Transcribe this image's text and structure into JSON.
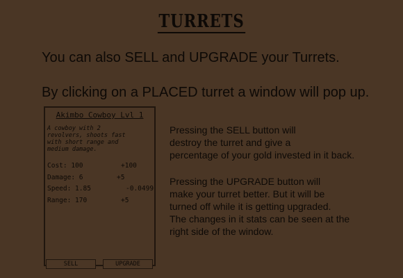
{
  "header": {
    "title": "TURRETS"
  },
  "intro": {
    "line1": "You can also SELL and UPGRADE your Turrets.",
    "line2": "By clicking on a PLACED turret a window will pop up."
  },
  "turret_window": {
    "name": "Akimbo Cowboy Lvl 1",
    "description": "A cowboy with 2\nrevolvers, shoots fast\nwith short range and\nmedium damage.",
    "stats": [
      {
        "label": "Cost: 100",
        "change": "+100"
      },
      {
        "label": "Damage: 6",
        "change": "+5"
      },
      {
        "label": "Speed: 1.85",
        "change": "-0.0499"
      },
      {
        "label": "Range: 170",
        "change": "+5"
      }
    ],
    "sell_label": "SELL",
    "upgrade_label": "UPGRADE"
  },
  "explanation": {
    "sell_lines": [
      "Pressing the SELL button will",
      "destroy the turret and give a",
      "percentage of your gold invested in it back."
    ],
    "upgrade_lines": [
      "Pressing the UPGRADE button will",
      "make your turret better. But it will be",
      "turned off while it is getting upgraded.",
      "The changes in it stats can be seen at the",
      "right side of the window."
    ]
  }
}
